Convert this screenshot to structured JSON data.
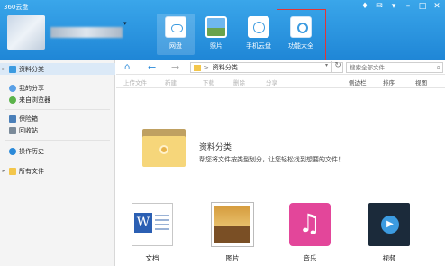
{
  "app": {
    "title": "360云盘"
  },
  "window_controls": [
    {
      "name": "skin-icon",
      "glyph": "♦"
    },
    {
      "name": "message-icon",
      "glyph": "✉"
    },
    {
      "name": "menu-icon",
      "glyph": "▾"
    },
    {
      "name": "minimize-icon",
      "glyph": "–"
    },
    {
      "name": "maximize-icon",
      "glyph": "□"
    },
    {
      "name": "close-icon",
      "glyph": "✕"
    }
  ],
  "user": {
    "caret": "▾"
  },
  "top_nav": [
    {
      "label": "网盘",
      "icon": "cloud-disk-icon",
      "active": true
    },
    {
      "label": "照片",
      "icon": "photo-icon"
    },
    {
      "label": "手机云盘",
      "icon": "phone-cloud-icon"
    },
    {
      "label": "功能大全",
      "icon": "tools-icon",
      "highlighted": true
    }
  ],
  "sidebar": {
    "items": [
      {
        "label": "资料分类",
        "selected": true,
        "caret": "▸"
      },
      {
        "label": "我的分享"
      },
      {
        "label": "来自浏览器"
      },
      {
        "label": "保险箱"
      },
      {
        "label": "回收站"
      },
      {
        "label": "操作历史"
      },
      {
        "label": "所有文件",
        "caret": "▸"
      }
    ]
  },
  "address_bar": {
    "home": "⌂",
    "back": "←",
    "forward": "→",
    "path_sep": ">",
    "path_current": "资料分类",
    "search_placeholder": "搜索全部文件",
    "search_glyph": "⌕",
    "refresh_glyph": "↻",
    "dropdown_glyph": "▾"
  },
  "toolbar": {
    "left": [
      "上传文件",
      "新建",
      "下载",
      "删除",
      "分享"
    ],
    "right": [
      "侧边栏",
      "排序",
      "视图"
    ]
  },
  "intro": {
    "title": "资料分类",
    "description": "帮您将文件按类型划分，让您轻松找到想要的文件！"
  },
  "file_categories": [
    {
      "label": "文档",
      "icon": "document-icon"
    },
    {
      "label": "图片",
      "icon": "image-icon"
    },
    {
      "label": "音乐",
      "icon": "music-icon"
    },
    {
      "label": "视频",
      "icon": "video-icon"
    }
  ],
  "colors": {
    "header": "#1f86d6",
    "accent": "#2b8ad9",
    "highlight_box": "#e23535"
  }
}
